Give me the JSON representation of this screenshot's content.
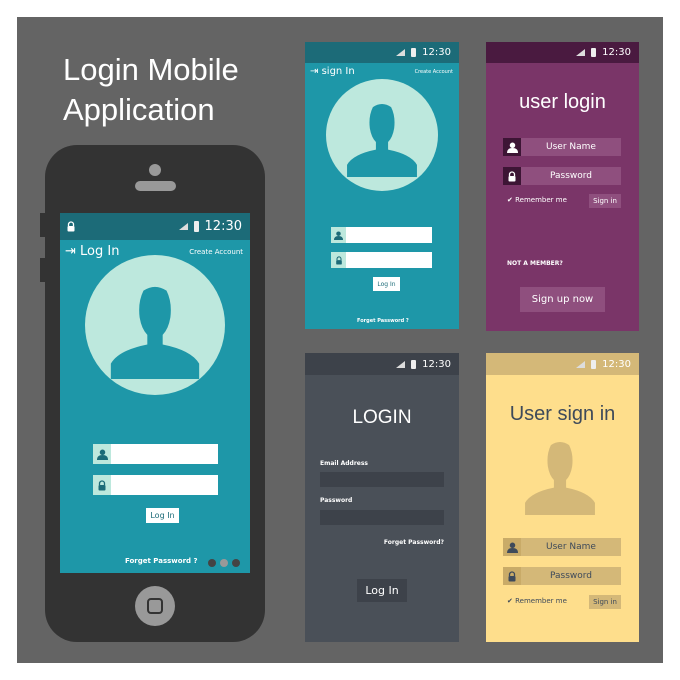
{
  "title": {
    "line1": "Login Mobile",
    "line2": "Application"
  },
  "time": "12:30",
  "phone": {
    "header": "Log In",
    "create_account": "Create Account",
    "login_button": "Log In",
    "forgot": "Forget Password ?"
  },
  "teal": {
    "header": "sign In",
    "create_account": "Create Account",
    "login_button": "Log In",
    "forgot": "Forget Password ?"
  },
  "purple": {
    "title": "user login",
    "username": "User Name",
    "password": "Password",
    "remember": "Remember me",
    "sign_in": "Sign in",
    "not_member": "NOT A MEMBER?",
    "sign_up": "Sign up now"
  },
  "dark": {
    "title": "LOGIN",
    "email_label": "Email Address",
    "password_label": "Password",
    "forgot": "Forget Password?",
    "login_button": "Log In"
  },
  "yellow": {
    "title": "User sign in",
    "username": "User Name",
    "password": "Password",
    "remember": "Remember me",
    "sign_in": "Sign in"
  },
  "colors": {
    "teal": "#1e97a8",
    "teal_dark": "#1c6b78",
    "purple": "#7a3568",
    "purple_dark": "#4a1a40",
    "slate": "#4a5058",
    "yellow": "#fede8c"
  }
}
